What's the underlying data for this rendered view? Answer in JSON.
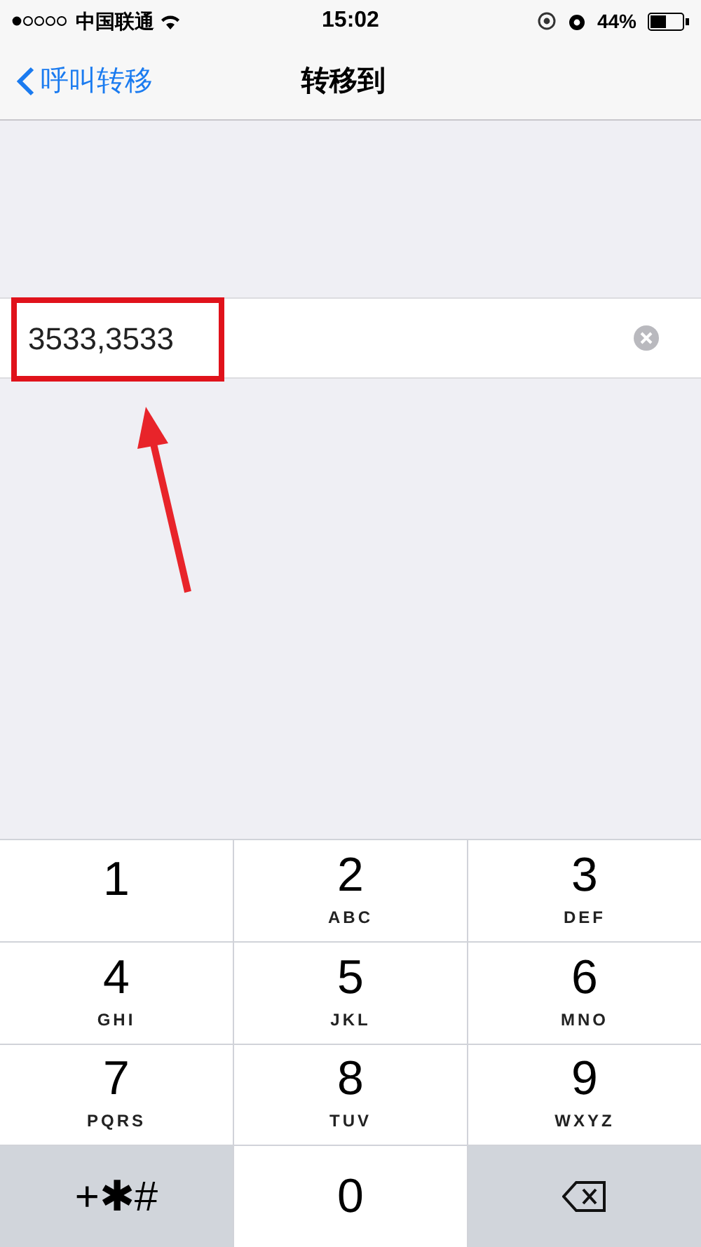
{
  "status_bar": {
    "carrier": "中国联通",
    "time": "15:02",
    "battery": "44%"
  },
  "nav": {
    "back": "呼叫转移",
    "title": "转移到"
  },
  "field": {
    "value": "3533,3533"
  },
  "keypad": [
    {
      "kind": "digit",
      "digit": "1"
    },
    {
      "kind": "digit",
      "digit": "2",
      "letters": "ABC"
    },
    {
      "kind": "digit",
      "digit": "3",
      "letters": "DEF"
    },
    {
      "kind": "digit",
      "digit": "4",
      "letters": "GHI"
    },
    {
      "kind": "digit",
      "digit": "5",
      "letters": "JKL"
    },
    {
      "kind": "digit",
      "digit": "6",
      "letters": "MNO"
    },
    {
      "kind": "digit",
      "digit": "7",
      "letters": "PQRS"
    },
    {
      "kind": "digit",
      "digit": "8",
      "letters": "TUV"
    },
    {
      "kind": "digit",
      "digit": "9",
      "letters": "WXYZ"
    },
    {
      "kind": "symbols",
      "label": "+✱#"
    },
    {
      "kind": "digit",
      "digit": "0"
    },
    {
      "kind": "delete"
    }
  ]
}
